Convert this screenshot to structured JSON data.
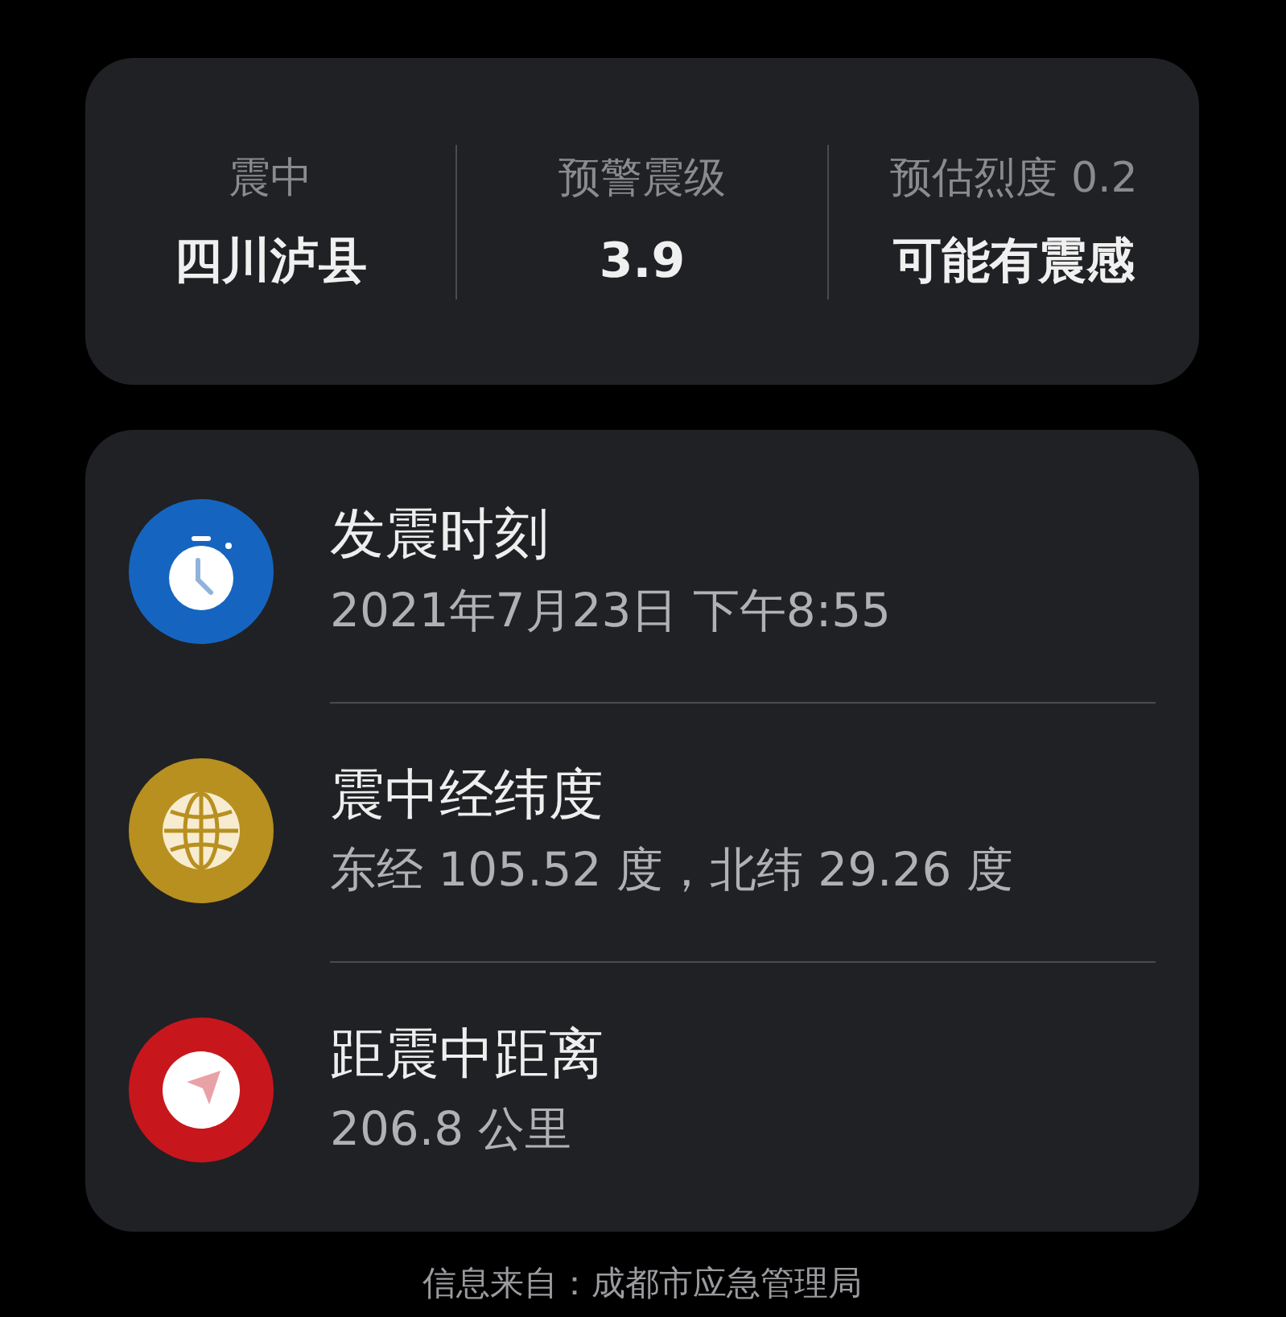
{
  "summary": [
    {
      "label": "震中",
      "value": "四川泸县"
    },
    {
      "label": "预警震级",
      "value": "3.9"
    },
    {
      "label": "预估烈度 0.2",
      "value": "可能有震感"
    }
  ],
  "details": [
    {
      "kind": "clock",
      "color": "#1565c0",
      "title": "发震时刻",
      "value": "2021年7月23日 下午8:55"
    },
    {
      "kind": "globe",
      "color": "#b8901f",
      "title": "震中经纬度",
      "value": "东经 105.52 度，北纬 29.26 度"
    },
    {
      "kind": "navigation",
      "color": "#c8161d",
      "title": "距震中距离",
      "value": "206.8 公里"
    }
  ],
  "footer": "信息来自：成都市应急管理局"
}
